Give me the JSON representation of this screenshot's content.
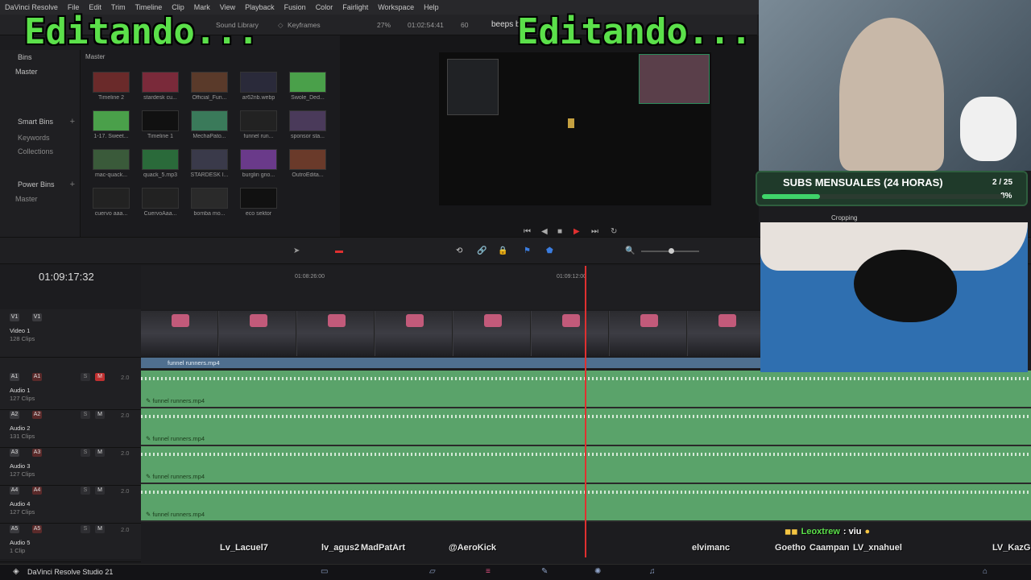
{
  "menu": [
    "DaVinci Resolve",
    "File",
    "Edit",
    "Trim",
    "Timeline",
    "Clip",
    "Mark",
    "View",
    "Playback",
    "Fusion",
    "Color",
    "Fairlight",
    "Workspace",
    "Help"
  ],
  "toolbar": {
    "sound_library": "Sound Library",
    "keyframes": "Keyframes",
    "zoom": "27%",
    "timecode": "01:02:54:41",
    "fps": "60",
    "title": "beeps b"
  },
  "overlay": {
    "left": "Editando...",
    "right": "Editando..."
  },
  "bins": {
    "header": "Bins",
    "master": "Master",
    "smart_bins": "Smart Bins",
    "keywords": "Keywords",
    "collections": "Collections",
    "power_bins": "Power Bins",
    "power_master": "Master"
  },
  "media": {
    "title": "Master",
    "clips": [
      {
        "label": "Timeline 2"
      },
      {
        "label": "stardesk cu..."
      },
      {
        "label": "Official_Fun..."
      },
      {
        "label": "ar62nb.webp"
      },
      {
        "label": "Swole_Ded..."
      },
      {
        "label": "1-17. Sweet..."
      },
      {
        "label": "Timeline 1"
      },
      {
        "label": "MechaPato..."
      },
      {
        "label": "funnel run..."
      },
      {
        "label": "sponsor sta..."
      },
      {
        "label": "mac-quack..."
      },
      {
        "label": "quack_5.mp3"
      },
      {
        "label": "STARDESK I..."
      },
      {
        "label": "burglin gno..."
      },
      {
        "label": "OutroEdita..."
      },
      {
        "label": "cuervo aaa..."
      },
      {
        "label": "CuervoAaa..."
      },
      {
        "label": "bomba mo..."
      },
      {
        "label": "eco sektor"
      }
    ]
  },
  "timeline": {
    "timecode": "01:09:17:32",
    "ruler": [
      "01:08:26:00",
      "01:09:12:00"
    ],
    "video": {
      "id": "V1",
      "name": "Video 1",
      "clips": "128 Clips",
      "clip_name": "funnel runners.mp4"
    },
    "audio": [
      {
        "id": "A1",
        "name": "Audio 1",
        "clips": "127 Clips",
        "level": "2.0",
        "clip_name": "funnel runners.mp4"
      },
      {
        "id": "A2",
        "name": "Audio 2",
        "clips": "131 Clips",
        "level": "2.0",
        "clip_name": "funnel runners.mp4"
      },
      {
        "id": "A3",
        "name": "Audio 3",
        "clips": "127 Clips",
        "level": "2.0",
        "clip_name": "funnel runners.mp4"
      },
      {
        "id": "A4",
        "name": "Audio 4",
        "clips": "127 Clips",
        "level": "2.0",
        "clip_name": "funnel runners.mp4"
      },
      {
        "id": "A5",
        "name": "Audio 5",
        "clips": "1 Clip",
        "level": "2.0"
      }
    ]
  },
  "stream": {
    "subs_title": "SUBS MENSUALES (24 HORAS)",
    "subs_count": "2 / 25",
    "subs_pct": "8%",
    "subs_progress": 0.08,
    "cropping": "Cropping",
    "chat_user": "Leoxtrew",
    "chat_msg": ": viu",
    "names": [
      "Lv_Lacuel7",
      "lv_agus2",
      "MadPatArt",
      "@AeroKick",
      "elvimanc",
      "Goetho",
      "Caampan",
      "LV_xnahuel",
      "LV_KazG"
    ]
  },
  "taskbar": {
    "app": "DaVinci Resolve Studio 21"
  }
}
